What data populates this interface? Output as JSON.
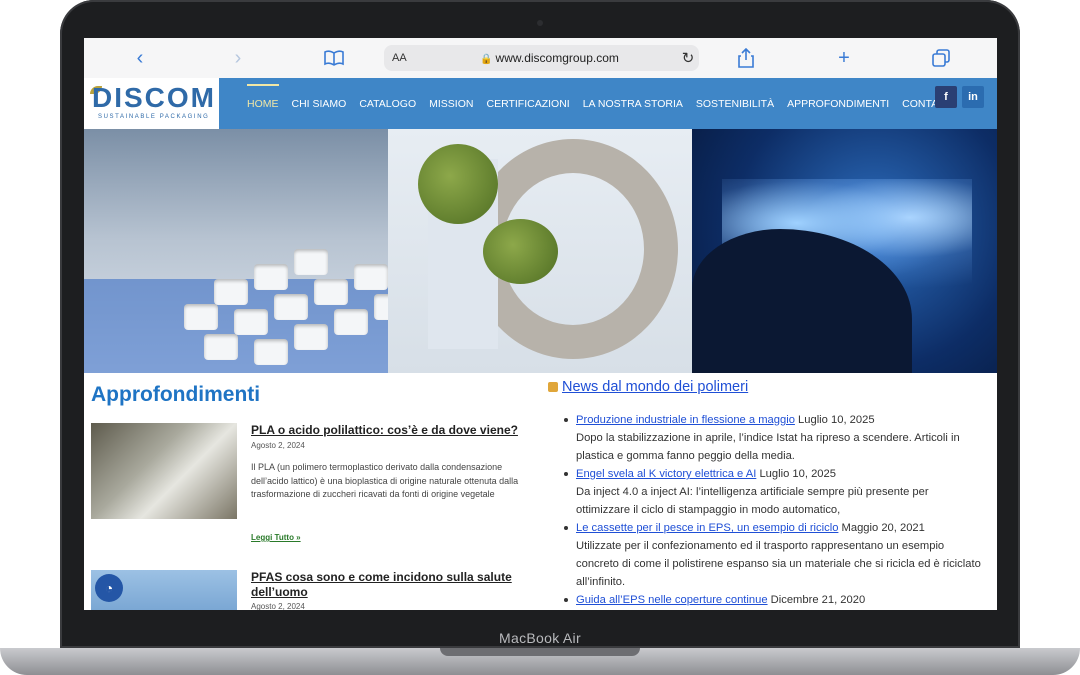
{
  "device": {
    "label": "MacBook Air"
  },
  "browser": {
    "text_size_label": "AA",
    "url": "www.discomgroup.com",
    "icons": [
      "back-icon",
      "forward-icon",
      "bookmarks-icon",
      "lock-icon",
      "reload-icon",
      "share-icon",
      "new-tab-icon",
      "tabs-icon"
    ]
  },
  "site": {
    "logo_text": "DISCOM",
    "logo_tagline": "SUSTAINABLE PACKAGING",
    "nav": [
      "HOME",
      "CHI SIAMO",
      "CATALOGO",
      "MISSION",
      "CERTIFICAZIONI",
      "LA NOSTRA STORIA",
      "SOSTENIBILITÀ",
      "APPROFONDIMENTI",
      "CONTATTI"
    ],
    "active_nav": "HOME",
    "colors": {
      "header": "#3f86c7",
      "accent": "#1f74c4",
      "active_nav": "#f1e7a6"
    },
    "social": [
      "facebook-icon",
      "linkedin-icon"
    ]
  },
  "approfondimenti": {
    "heading": "Approfondimenti",
    "articles": [
      {
        "title": "PLA o acido polilattico: cos’è e da dove viene?",
        "date": "Agosto 2, 2024",
        "excerpt": "Il PLA (un polimero termoplastico derivato dalla condensazione dell’acido lattico) è una bioplastica di origine naturale ottenuta dalla trasformazione di zuccheri ricavati da fonti di origine vegetale",
        "more": "Leggi Tutto »"
      },
      {
        "title": "PFAS cosa sono e come incidono sulla salute dell’uomo",
        "date": "Agosto 2, 2024"
      }
    ]
  },
  "news": {
    "heading": "News dal mondo dei polimeri",
    "items": [
      {
        "link": "Produzione industriale in flessione a maggio",
        "date": "Luglio 10, 2025",
        "summary": "Dopo la stabilizzazione in aprile, l’indice Istat ha ripreso a scendere. Articoli in plastica e gomma fanno peggio della media."
      },
      {
        "link": "Engel svela al K victory elettrica e AI",
        "date": "Luglio 10, 2025",
        "summary": "Da inject 4.0 a inject AI: l’intelligenza artificiale sempre più presente per ottimizzare il ciclo di stampaggio in modo automatico,"
      },
      {
        "link": "Le cassette per il pesce in EPS, un esempio di riciclo",
        "date": "Maggio 20, 2021",
        "summary": "Utilizzate per il confezionamento ed il trasporto rappresentano un esempio concreto di come il polistirene espanso sia un materiale che si ricicla ed è riciclato all’infinito."
      },
      {
        "link": "Guida all’EPS nelle coperture continue",
        "date": "Dicembre 21, 2020",
        "summary": ""
      }
    ]
  }
}
